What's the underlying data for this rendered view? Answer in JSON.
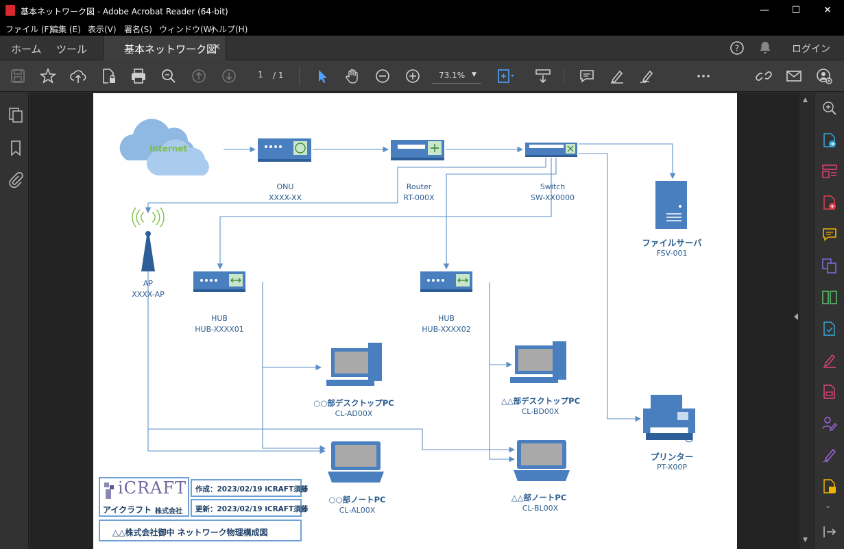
{
  "window": {
    "title": "基本ネットワーク図 - Adobe Acrobat Reader (64-bit)",
    "min": "—",
    "max": "☐",
    "close": "✕"
  },
  "menu": [
    "ファイル (F)",
    "編集 (E)",
    "表示(V)",
    "署名(S)",
    "ウィンドウ(W)",
    "ヘルプ(H)"
  ],
  "tabs": {
    "home": "ホーム",
    "tools": "ツール",
    "doc": "基本ネットワーク図",
    "close": "×",
    "login": "ログイン"
  },
  "toolbar": {
    "page_current": "1",
    "page_total": "/ 1",
    "zoom": "73.1%"
  },
  "diagram": {
    "internet": "Internet",
    "onu": {
      "name": "ONU",
      "id": "XXXX-XX"
    },
    "router": {
      "name": "Router",
      "id": "RT-000X"
    },
    "switch": {
      "name": "Switch",
      "id": "SW-XX0000"
    },
    "server": {
      "name": "ファイルサーバ",
      "id": "FSV-001"
    },
    "ap": {
      "name": "AP",
      "id": "XXXX-AP"
    },
    "hub1": {
      "name": "HUB",
      "id": "HUB-XXXX01"
    },
    "hub2": {
      "name": "HUB",
      "id": "HUB-XXXX02"
    },
    "desk1": {
      "name": "○○部デスクトップPC",
      "id": "CL-AD00X"
    },
    "desk2": {
      "name": "△△部デスクトップPC",
      "id": "CL-BD00X"
    },
    "note1": {
      "name": "○○部ノートPC",
      "id": "CL-AL00X"
    },
    "note2": {
      "name": "△△部ノートPC",
      "id": "CL-BL00X"
    },
    "printer": {
      "name": "プリンター",
      "id": "PT-X00P"
    }
  },
  "titleblock": {
    "logo": "iCRAFT",
    "logo_kana": "アイクラフト",
    "logo_corp": "株式会社",
    "created": "作成：2023/02/19 iCRAFT須藤",
    "updated": "更新：2023/02/19 iCRAFT須藤",
    "caption": "△△株式会社御中 ネットワーク物理構成図"
  },
  "colors": {
    "line": "#5b8fc7",
    "device": "#4a7fbf",
    "text": "#2c5d8f",
    "accent_green": "#7ac143"
  }
}
